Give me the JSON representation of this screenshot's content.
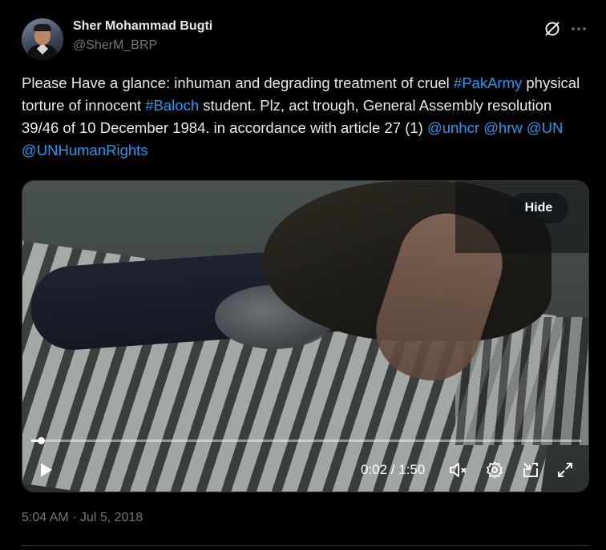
{
  "author": {
    "name": "Sher Mohammad Bugti",
    "handle": "@SherM_BRP"
  },
  "tweet": {
    "parts": [
      {
        "text": "Please Have a glance: inhuman and degrading treatment of cruel ",
        "link": false
      },
      {
        "text": "#PakArmy",
        "link": true
      },
      {
        "text": " physical torture of innocent ",
        "link": false
      },
      {
        "text": "#Baloch",
        "link": true
      },
      {
        "text": " student. Plz, act trough, General Assembly resolution 39/46 of 10 December 1984. in accordance with article 27 (1) ",
        "link": false
      },
      {
        "text": "@unhcr",
        "link": true
      },
      {
        "text": " ",
        "link": false
      },
      {
        "text": "@hrw",
        "link": true
      },
      {
        "text": " ",
        "link": false
      },
      {
        "text": "@UN",
        "link": true
      },
      {
        "text": " ",
        "link": false
      },
      {
        "text": "@UNHumanRights",
        "link": true
      }
    ],
    "timestamp": "5:04 AM · Jul 5, 2018"
  },
  "video": {
    "hide_label": "Hide",
    "time": "0:02 / 1:50",
    "progress_fraction": 0.018
  },
  "icons": {
    "grok": "grok-icon",
    "more": "more-icon",
    "play": "play-icon",
    "mute": "mute-icon",
    "settings": "settings-icon",
    "pip": "pip-icon",
    "fullscreen": "fullscreen-icon"
  },
  "colors": {
    "background": "#000000",
    "text": "#e7e9ea",
    "secondary": "#71767b",
    "link": "#1d9bf0",
    "divider": "#2f3336"
  }
}
